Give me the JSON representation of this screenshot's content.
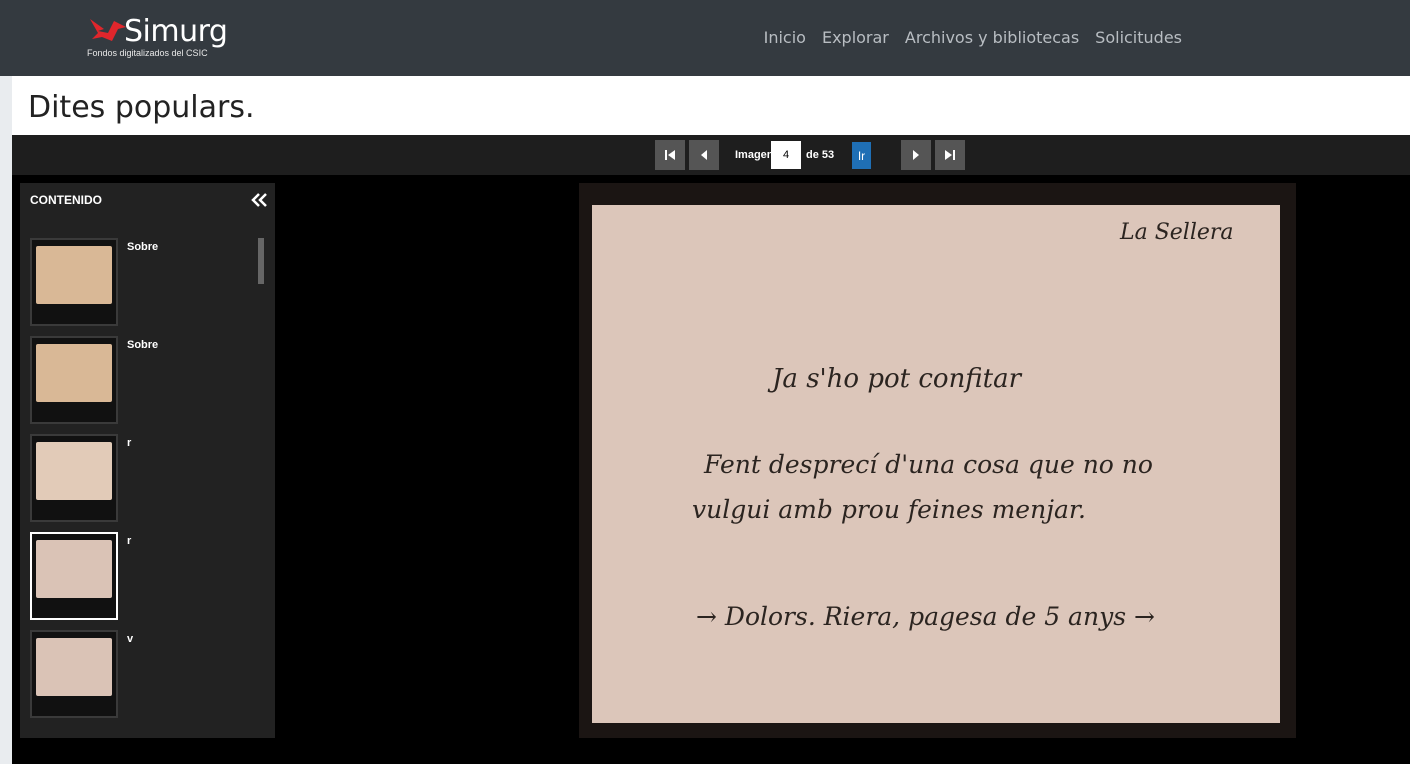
{
  "header": {
    "logo_text": "Simurg",
    "logo_tagline": "Fondos digitalizados del CSIC",
    "nav": [
      "Inicio",
      "Explorar",
      "Archivos y bibliotecas",
      "Solicitudes"
    ],
    "colors": {
      "bar": "#343a40",
      "logo_bird": "#e0262c"
    }
  },
  "page": {
    "title": "Dites populars."
  },
  "pager": {
    "label_before": "Imagen",
    "current": "4",
    "label_after": "de 53",
    "go_label": "Ir",
    "icons": [
      "first-page-icon",
      "prev-page-icon",
      "next-page-icon",
      "last-page-icon"
    ],
    "go_color": "#1f6fb5"
  },
  "sidebar": {
    "heading": "CONTENIDO",
    "collapse_icon": "double-chevron-left-icon",
    "items": [
      {
        "label": "Sobre",
        "active": false
      },
      {
        "label": "Sobre",
        "active": false
      },
      {
        "label": "r",
        "active": false
      },
      {
        "label": "r",
        "active": true
      },
      {
        "label": "v",
        "active": false
      }
    ]
  },
  "document": {
    "lines": [
      "La Sellera",
      "Ja s'ho pot confitar",
      "Fent desprecí d'una cosa que no no",
      "vulgui amb prou feines menjar.",
      "→ Dolors. Riera, pagesa de 5 anys →"
    ]
  }
}
